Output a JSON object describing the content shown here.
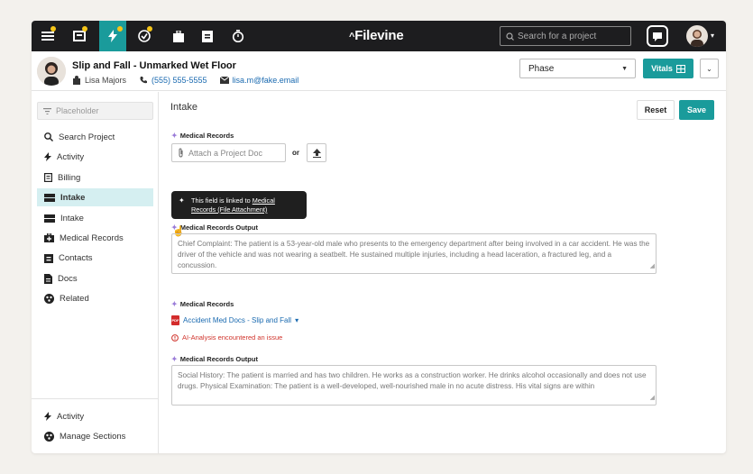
{
  "topbar": {
    "logo": "Filevine",
    "search_placeholder": "Search for a project",
    "tools": [
      "menu-icon",
      "news-icon",
      "lightning-icon",
      "check-icon",
      "briefcase-icon",
      "contact-card-icon",
      "timer-icon"
    ]
  },
  "project": {
    "title": "Slip and Fall - Unmarked Wet Floor",
    "client": "Lisa Majors",
    "phone": "(555) 555-5555",
    "email": "lisa.m@fake.email",
    "phase_label": "Phase",
    "vitals_label": "Vitals"
  },
  "sidebar": {
    "placeholder": "Placeholder",
    "items": [
      {
        "label": "Search Project",
        "icon": "search-icon"
      },
      {
        "label": "Activity",
        "icon": "lightning-icon"
      },
      {
        "label": "Billing",
        "icon": "receipt-icon"
      },
      {
        "label": "Intake",
        "icon": "intake-icon",
        "active": true
      },
      {
        "label": "Intake",
        "icon": "intake-icon"
      },
      {
        "label": "Medical Records",
        "icon": "medical-icon"
      },
      {
        "label": "Contacts",
        "icon": "contacts-icon"
      },
      {
        "label": "Docs",
        "icon": "doc-icon"
      },
      {
        "label": "Related",
        "icon": "related-icon"
      }
    ],
    "footer": [
      {
        "label": "Activity",
        "icon": "lightning-icon"
      },
      {
        "label": "Manage Sections",
        "icon": "settings-icon"
      }
    ]
  },
  "main": {
    "section_title": "Intake",
    "reset_label": "Reset",
    "save_label": "Save",
    "field1_label": "Medical Records",
    "attach_placeholder": "Attach a Project Doc",
    "or_label": "or",
    "tooltip_text": "This field is linked to",
    "tooltip_link": "Medical Records (File Attachment)",
    "field2_label": "Medical Records Output",
    "output1": "Chief Complaint: The patient is a 53-year-old male who presents to the emergency department after being involved in a car accident. He was the driver of the vehicle and was not wearing a seatbelt. He sustained multiple injuries, including a head laceration, a fractured leg, and a concussion.",
    "field3_label": "Medical Records",
    "doc_name": "Accident Med Docs - Slip and Fall",
    "error_text": "AI-Analysis encountered an issue",
    "field4_label": "Medical Records Output",
    "output2": "Social History: The patient is married and has two children. He works as a construction worker. He drinks alcohol occasionally and does not use drugs. Physical Examination: The patient is a well-developed, well-nourished male in no acute distress. His vital signs are within"
  },
  "colors": {
    "accent": "#1a9b9b",
    "error": "#d0342c",
    "link": "#1a6ab0"
  }
}
